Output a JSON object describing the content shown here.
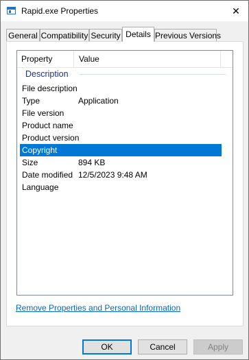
{
  "window": {
    "title": "Rapid.exe Properties",
    "close_glyph": "✕"
  },
  "tabs": [
    {
      "label": "General"
    },
    {
      "label": "Compatibility"
    },
    {
      "label": "Security"
    },
    {
      "label": "Details",
      "active": true
    },
    {
      "label": "Previous Versions"
    }
  ],
  "details": {
    "columns": {
      "property": "Property",
      "value": "Value"
    },
    "group": "Description",
    "rows": [
      {
        "property": "File description",
        "value": ""
      },
      {
        "property": "Type",
        "value": "Application"
      },
      {
        "property": "File version",
        "value": ""
      },
      {
        "property": "Product name",
        "value": ""
      },
      {
        "property": "Product version",
        "value": ""
      },
      {
        "property": "Copyright",
        "value": "",
        "selected": true
      },
      {
        "property": "Size",
        "value": "894 KB"
      },
      {
        "property": "Date modified",
        "value": "12/5/2023 9:48 AM"
      },
      {
        "property": "Language",
        "value": ""
      }
    ]
  },
  "link": {
    "label": "Remove Properties and Personal Information"
  },
  "buttons": {
    "ok": "OK",
    "cancel": "Cancel",
    "apply": "Apply"
  },
  "colors": {
    "selection": "#0078d7",
    "group_text": "#1e3287",
    "link": "#0066cc"
  }
}
